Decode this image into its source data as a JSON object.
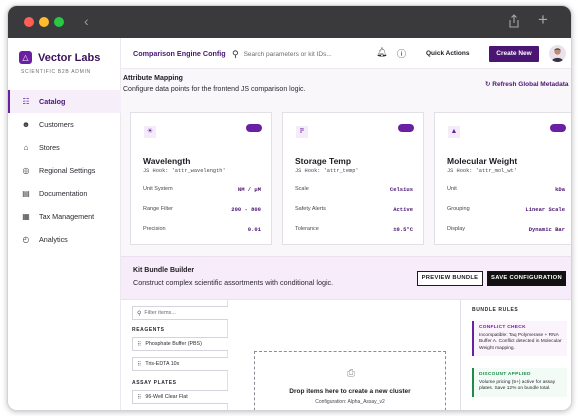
{
  "app": {
    "name": "Vector Labs",
    "subtitle": "SCIENTIFIC B2B ADMIN"
  },
  "sidebar": {
    "items": [
      {
        "label": "Catalog",
        "icon": "book-icon",
        "active": true
      },
      {
        "label": "Customers",
        "icon": "users-icon",
        "active": false
      },
      {
        "label": "Stores",
        "icon": "store-icon",
        "active": false
      },
      {
        "label": "Regional Settings",
        "icon": "globe-icon",
        "active": false
      },
      {
        "label": "Documentation",
        "icon": "document-icon",
        "active": false
      },
      {
        "label": "Tax Management",
        "icon": "receipt-icon",
        "active": false
      },
      {
        "label": "Analytics",
        "icon": "analytics-icon",
        "active": false
      }
    ]
  },
  "header": {
    "title": "Comparison Engine Config",
    "search_placeholder": "Search parameters or kit IDs...",
    "quick_actions": "Quick Actions",
    "create_new": "Create New"
  },
  "attributes": {
    "title": "Attribute Mapping",
    "description": "Configure data points for the frontend JS comparison logic.",
    "refresh": "Refresh Global Metadata",
    "cards": [
      {
        "name": "Wavelength",
        "hook": "JS Hook: 'attr_wavelength'",
        "icon": "sun-icon",
        "rows": [
          {
            "label": "Unit System",
            "value": "NM / µM"
          },
          {
            "label": "Range Filter",
            "value": "200 - 800"
          },
          {
            "label": "Precision",
            "value": "0.01"
          }
        ]
      },
      {
        "name": "Storage Temp",
        "hook": "JS Hook: 'attr_temp'",
        "icon": "thermometer-icon",
        "rows": [
          {
            "label": "Scale",
            "value": "Celsius"
          },
          {
            "label": "Safety Alerts",
            "value": "Active"
          },
          {
            "label": "Tolerance",
            "value": "±0.5°C"
          }
        ]
      },
      {
        "name": "Molecular Weight",
        "hook": "JS Hook: 'attr_mol_wt'",
        "icon": "weight-icon",
        "rows": [
          {
            "label": "Unit",
            "value": "kDa"
          },
          {
            "label": "Grouping",
            "value": "Linear Scale"
          },
          {
            "label": "Display",
            "value": "Dynamic Bar"
          }
        ]
      }
    ]
  },
  "kit": {
    "title": "Kit Bundle Builder",
    "description": "Construct complex scientific assortments with conditional logic.",
    "preview": "PREVIEW BUNDLE",
    "save": "SAVE CONFIGURATION"
  },
  "library": {
    "filter_placeholder": "Filter items...",
    "groups": [
      {
        "label": "REAGENTS",
        "items": [
          "Phosphate Buffer (PBS)",
          "Tris-EDTA 10x"
        ]
      },
      {
        "label": "ASSAY PLATES",
        "items": [
          "96-Well Clear Flat"
        ]
      }
    ]
  },
  "canvas": {
    "drop_title": "Drop items here to create a new cluster",
    "drop_sub": "Configuration: Alpha_Assay_v2"
  },
  "rules": {
    "title": "BUNDLE RULES",
    "items": [
      {
        "title": "CONFLICT CHECK",
        "body": "Incompatible: Taq Polymerase + RNA Buffer A. Conflict detected in Molecular Weight mapping."
      },
      {
        "title": "DISCOUNT APPLIED",
        "body": "Volume pricing (5+) active for assay plates. Save 12% on bundle total."
      }
    ]
  }
}
